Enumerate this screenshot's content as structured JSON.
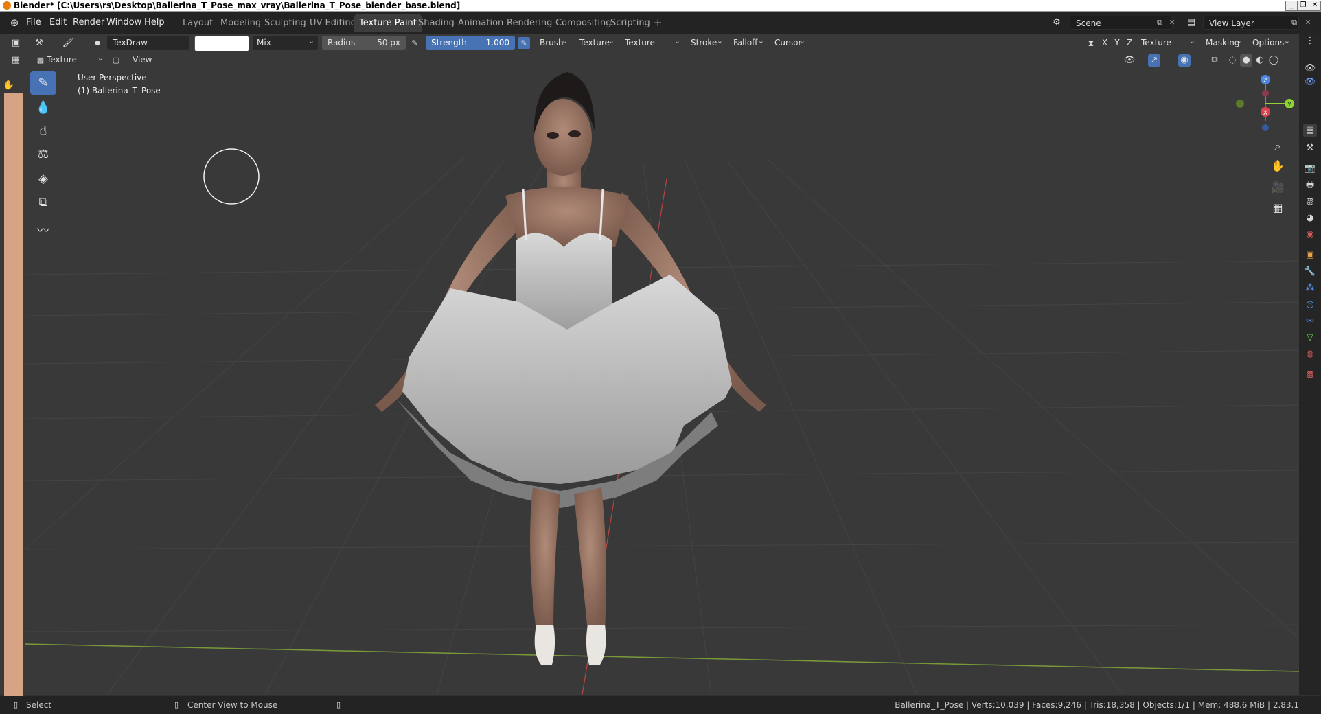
{
  "window": {
    "title": "Blender* [C:\\Users\\rs\\Desktop\\Ballerina_T_Pose_max_vray\\Ballerina_T_Pose_blender_base.blend]"
  },
  "menu": [
    "File",
    "Edit",
    "Render",
    "Window",
    "Help"
  ],
  "workspaces": {
    "tabs": [
      "Layout",
      "Modeling",
      "Sculpting",
      "UV Editing",
      "Texture Paint",
      "Shading",
      "Animation",
      "Rendering",
      "Compositing",
      "Scripting"
    ],
    "active": "Texture Paint",
    "add": "+"
  },
  "scene": {
    "name": "Scene"
  },
  "view_layer": {
    "name": "View Layer"
  },
  "tool_header": {
    "brush_name": "TexDraw",
    "color_hex": "#ffffff",
    "blend": "Mix",
    "radius_label": "Radius",
    "radius_value": "50 px",
    "strength_label": "Strength",
    "strength_value": "1.000",
    "menus": [
      "Brush",
      "Texture",
      "Texture Mask",
      "Stroke",
      "Falloff",
      "Cursor"
    ],
    "axes": [
      "X",
      "Y",
      "Z"
    ],
    "right_menus": [
      "Texture Slots",
      "Masking",
      "Options"
    ]
  },
  "view_header": {
    "mode": "Texture Paint",
    "view": "View"
  },
  "viewport": {
    "perspective": "User Perspective",
    "object": "(1) Ballerina_T_Pose"
  },
  "gizmo": {
    "z": "Z",
    "y": "Y",
    "x": "X"
  },
  "status": {
    "select": "Select",
    "center": "Center View to Mouse",
    "stats": "Ballerina_T_Pose | Verts:10,039 | Faces:9,246 | Tris:18,358 | Objects:1/1 | Mem: 488.6 MiB | 2.83.1"
  },
  "colors": {
    "accent": "#4772b3",
    "header": "#393939",
    "topbar": "#232323",
    "viewport": "#3a3a3a",
    "tool_strip": "#d6a485"
  }
}
